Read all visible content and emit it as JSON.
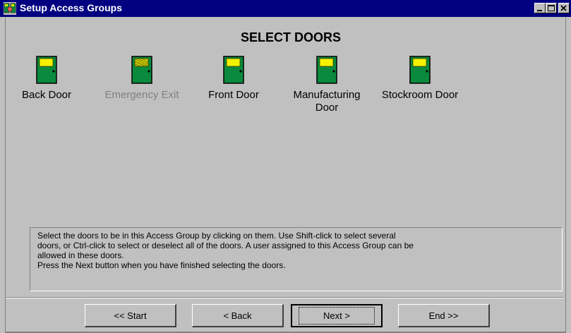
{
  "window": {
    "title": "Setup Access Groups"
  },
  "page": {
    "heading": "SELECT DOORS"
  },
  "doors": [
    {
      "label": "Back Door",
      "enabled": true
    },
    {
      "label": "Emergency Exit",
      "enabled": false
    },
    {
      "label": "Front Door",
      "enabled": true
    },
    {
      "label": "Manufacturing\nDoor",
      "enabled": true
    },
    {
      "label": "Stockroom Door",
      "enabled": true
    }
  ],
  "instructions": {
    "line1": "Select the doors to be in this Access Group by clicking on them.  Use Shift-click to select several",
    "line2": "doors, or Ctrl-click to select or deselect all of the doors.  A user assigned to this Access Group can be",
    "line3": "allowed in these doors.",
    "line4": "Press the Next button when you have finished selecting the doors."
  },
  "buttons": {
    "start": "<< Start",
    "back": "< Back",
    "next": "Next >",
    "end": "End >>"
  },
  "colors": {
    "title_bar": "#000080",
    "window_bg": "#c0c0c0",
    "door_green": "#0a8a3c",
    "door_window_yellow": "#f4f200"
  },
  "icons": {
    "app": "app-icon",
    "minimize": "minimize-icon",
    "maximize": "maximize-icon",
    "close": "close-icon",
    "door": "door-icon"
  }
}
